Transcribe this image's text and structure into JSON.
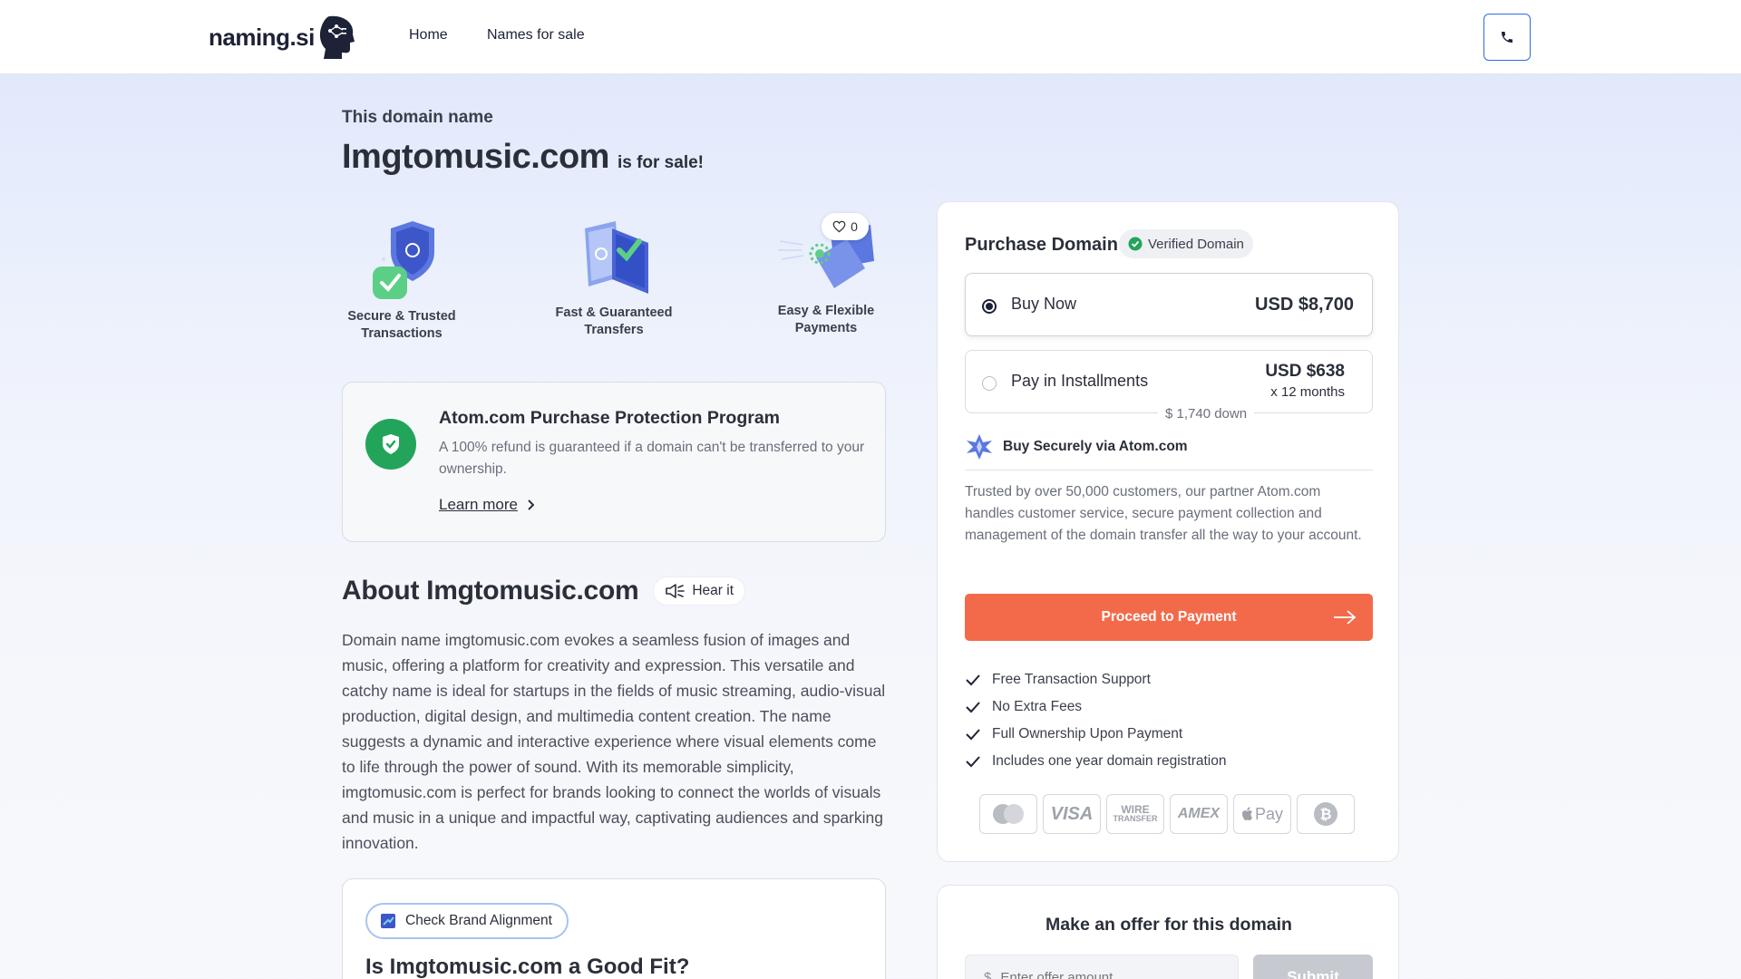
{
  "header": {
    "logo_text": "naming.si",
    "nav": [
      "Home",
      "Names for sale"
    ]
  },
  "hero": {
    "eyebrow": "This domain name",
    "domain": "Imgtomusic.com",
    "for_sale": "is for sale!"
  },
  "features": [
    {
      "label_line1": "Secure & Trusted",
      "label_line2": "Transactions",
      "icon": "shield-check-icon"
    },
    {
      "label_line1": "Fast & Guaranteed",
      "label_line2": "Transfers",
      "icon": "transfer-cards-icon"
    },
    {
      "label_line1": "Easy & Flexible",
      "label_line2": "Payments",
      "icon": "payment-card-icon"
    }
  ],
  "likes": "0",
  "protection": {
    "title": "Atom.com Purchase Protection Program",
    "desc": "A 100% refund is guaranteed if a domain can't be transferred to your ownership.",
    "link": "Learn more"
  },
  "about": {
    "title": "About Imgtomusic.com",
    "hear_label": "Hear it",
    "text": "Domain name imgtomusic.com evokes a seamless fusion of images and music, offering a platform for creativity and expression. This versatile and catchy name is ideal for startups in the fields of music streaming, audio-visual production, digital design, and multimedia content creation. The name suggests a dynamic and interactive experience where visual elements come to life through the power of sound. With its memorable simplicity, imgtomusic.com is perfect for brands looking to connect the worlds of visuals and music in a unique and impactful way, captivating audiences and sparking innovation."
  },
  "fit": {
    "brand_label": "Check Brand Alignment",
    "title": "Is Imgtomusic.com a Good Fit?"
  },
  "purchase": {
    "title": "Purchase Domain",
    "verified": "Verified Domain",
    "buy_now_label": "Buy Now",
    "buy_now_price": "USD $8,700",
    "installments_label": "Pay in Installments",
    "installments_price": "USD $638",
    "installments_months": "x 12 months",
    "down": "$ 1,740 down",
    "atom_label": "Buy Securely via Atom.com",
    "trust_text": "Trusted by over 50,000 customers, our partner Atom.com handles customer service, secure payment collection and management of the domain transfer all the way to your account.",
    "proceed": "Proceed to Payment",
    "checks": [
      "Free Transaction Support",
      "No Extra Fees",
      "Full Ownership Upon Payment",
      "Includes one year domain registration"
    ],
    "payment_methods": [
      "mastercard-icon",
      "visa-icon",
      "wire-transfer-icon",
      "amex-icon",
      "apple-pay-icon",
      "bitcoin-icon"
    ],
    "visa_text": "VISA",
    "wire_text_1": "WIRE",
    "wire_text_2": "TRANSFER",
    "amex_text": "AMEX",
    "applepay_text": "Pay"
  },
  "offer": {
    "title": "Make an offer for this domain",
    "currency": "$",
    "placeholder": "Enter offer amount",
    "submit": "Submit"
  },
  "colors": {
    "accent_orange": "#f36a4b",
    "brand_blue": "#2a6fd6",
    "verified_green": "#23a45b"
  }
}
